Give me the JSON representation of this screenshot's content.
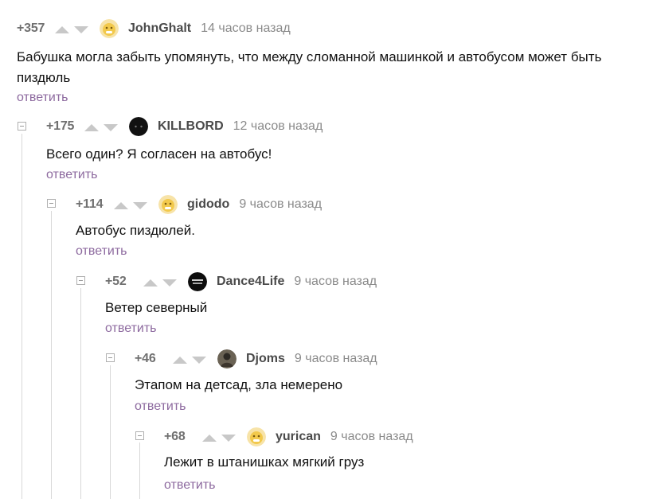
{
  "comments": [
    {
      "score": "+357",
      "username": "JohnGhalt",
      "time": "14 часов назад",
      "text": "Бабушка могла забыть упомянуть, что между сломанной машинкой и автобусом может быть пиздюль",
      "reply": "ответить",
      "avatar": "emoji-face-avatar"
    },
    {
      "score": "+175",
      "username": "KILLBORD",
      "time": "12 часов назад",
      "text": "Всего один? Я согласен на автобус!",
      "reply": "ответить",
      "avatar": "dark-face-avatar"
    },
    {
      "score": "+114",
      "username": "gidodo",
      "time": "9 часов назад",
      "text": "Автобус пиздюлей.",
      "reply": "ответить",
      "avatar": "emoji-face-avatar"
    },
    {
      "score": "+52",
      "username": "Dance4Life",
      "time": "9 часов назад",
      "text": "Ветер северный",
      "reply": "ответить",
      "avatar": "dark-logo-avatar"
    },
    {
      "score": "+46",
      "username": "Djoms",
      "time": "9 часов назад",
      "text": "Этапом на детсад, зла немерено",
      "reply": "ответить",
      "avatar": "photo-avatar"
    },
    {
      "score": "+68",
      "username": "yurican",
      "time": "9 часов назад",
      "text": "Лежит в штанишках мягкий груз",
      "reply": "ответить",
      "avatar": "emoji-face-avatar"
    }
  ],
  "colors": {
    "reply_link": "#8d6a9f",
    "score": "#707070",
    "vote_arrow": "#c8c8c8",
    "thread_line": "#d8d8d8"
  }
}
